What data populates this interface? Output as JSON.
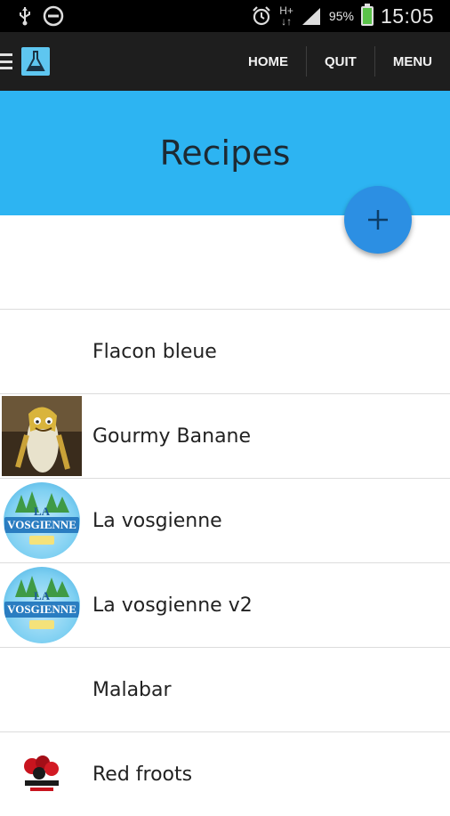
{
  "status_bar": {
    "icons": [
      "usb-icon",
      "minus-circle-icon",
      "alarm-icon",
      "network-h-plus-icon",
      "signal-icon",
      "battery-charging-icon"
    ],
    "network_label": "H+",
    "battery_percent": "95%",
    "battery_level": 0.95,
    "time": "15:05"
  },
  "action_bar": {
    "menu_icon": "hamburger-icon",
    "app_icon": "flask-icon",
    "buttons": {
      "home": "HOME",
      "quit": "QUIT",
      "menu": "MENU"
    }
  },
  "header": {
    "title": "Recipes"
  },
  "fab": {
    "icon": "plus-icon"
  },
  "recipes": [
    {
      "name": "Flacon bleue",
      "thumbnail": "none"
    },
    {
      "name": "Gourmy Banane",
      "thumbnail": "banana-character-image"
    },
    {
      "name": "La vosgienne",
      "thumbnail": "vosgienne-logo-image"
    },
    {
      "name": "La vosgienne v2",
      "thumbnail": "vosgienne-logo-image"
    },
    {
      "name": "Malabar",
      "thumbnail": "none"
    },
    {
      "name": "Red froots",
      "thumbnail": "red-froots-logo-image"
    }
  ],
  "colors": {
    "status_bar_bg": "#000000",
    "action_bar_bg": "#1e1e1e",
    "header_bg": "#2db4f2",
    "fab_bg": "#2c8fe3",
    "list_divider": "#dcdcdc"
  }
}
